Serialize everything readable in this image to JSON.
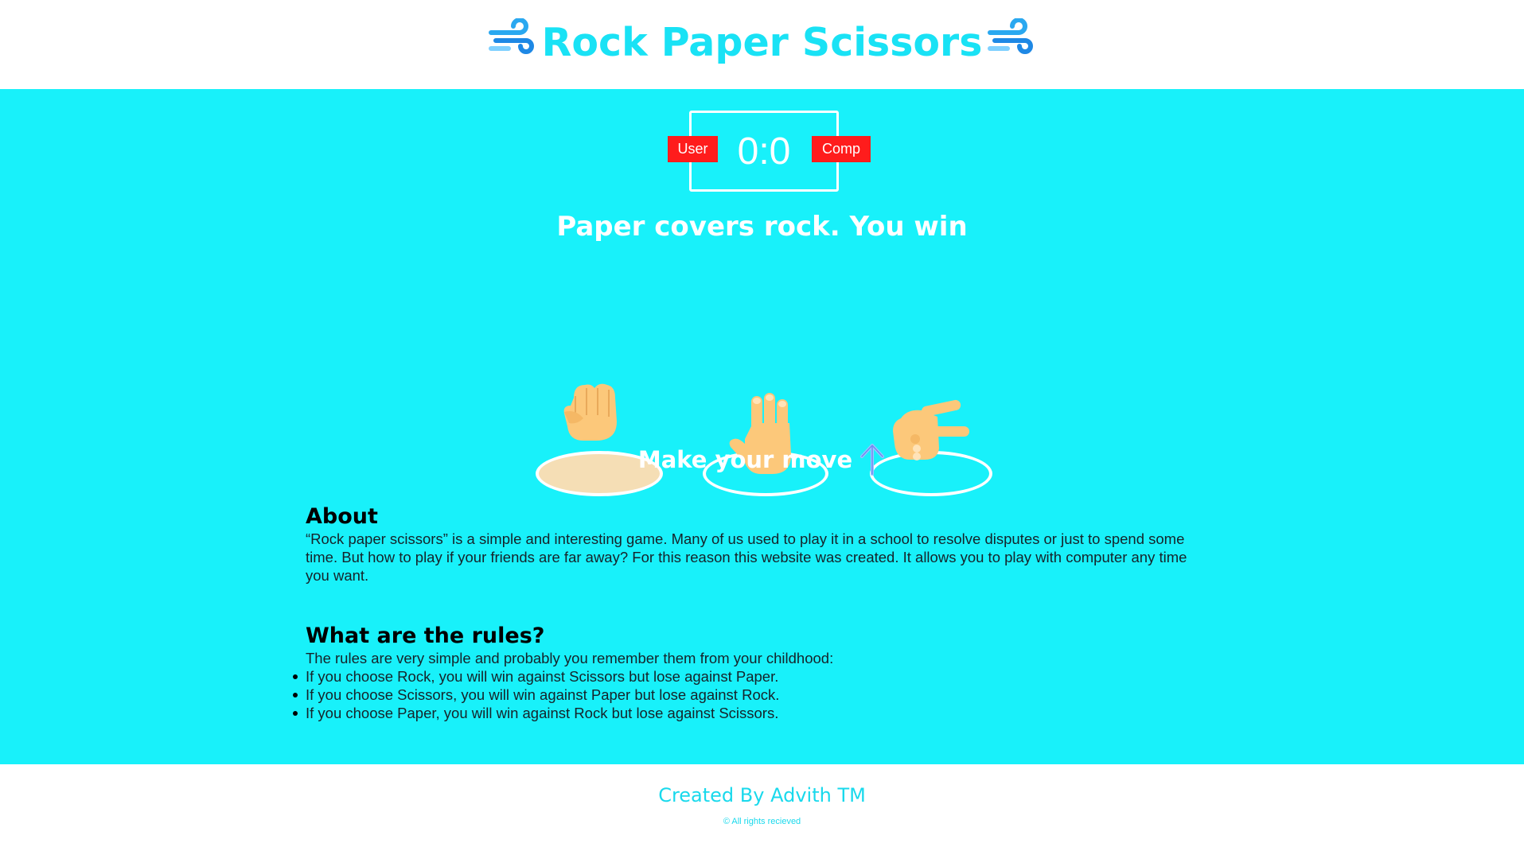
{
  "header": {
    "title": "Rock Paper Scissors",
    "title_icon": "wind-icon",
    "title_color": "#19e2f5"
  },
  "scoreboard": {
    "score": "0:0",
    "user_label": "User",
    "comp_label": "Comp",
    "badge_color": "#ff1c1c"
  },
  "result": {
    "message": "Paper covers rock. You win"
  },
  "choices": [
    {
      "name": "rock",
      "icon": "fist-hand-icon",
      "selected": true
    },
    {
      "name": "paper",
      "icon": "open-hand-icon",
      "selected": false
    },
    {
      "name": "scissors",
      "icon": "victory-hand-icon",
      "selected": false
    }
  ],
  "prompt": {
    "text": "Make your move",
    "icon": "arrow-up-icon"
  },
  "about": {
    "title": "About",
    "text": "“Rock paper scissors” is a simple and interesting game. Many of us used to play it in a school to resolve disputes or just to spend some time. But how to play if your friends are far away? For this reason this website was created. It allows you to play with computer any time you want."
  },
  "rules": {
    "title": "What are the rules?",
    "intro": "The rules are very simple and probably you remember them from your childhood:",
    "items": [
      "If you choose Rock, you will win against Scissors but lose against Paper.",
      "If you choose Scissors, you will win against Paper but lose against Rock.",
      "If you choose Paper, you will win against Rock but lose against Scissors."
    ]
  },
  "footer": {
    "credit": "Created By Advith TM",
    "rights": "© All rights recieved"
  },
  "colors": {
    "background": "#18f1fa",
    "accent": "#19e2f5"
  }
}
